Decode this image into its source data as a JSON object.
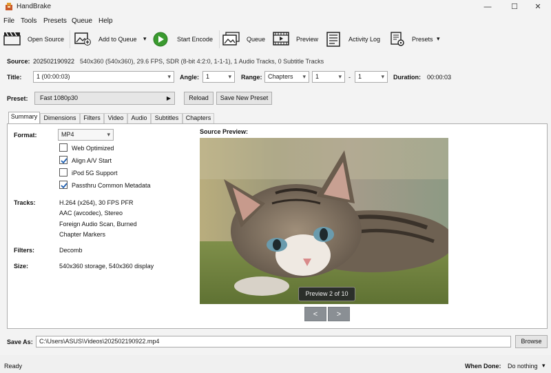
{
  "window": {
    "title": "HandBrake",
    "controls": [
      "—",
      "☐",
      "✕"
    ]
  },
  "menu": [
    "File",
    "Tools",
    "Presets",
    "Queue",
    "Help"
  ],
  "toolbar": {
    "open_source": "Open Source",
    "add_to_queue": "Add to Queue",
    "start_encode": "Start Encode",
    "queue": "Queue",
    "preview": "Preview",
    "activity_log": "Activity Log",
    "presets": "Presets"
  },
  "source": {
    "label": "Source:",
    "name": "202502190922",
    "info": "540x360 (540x360), 29.6 FPS, SDR (8-bit 4:2:0, 1-1-1), 1 Audio Tracks, 0 Subtitle Tracks"
  },
  "title_row": {
    "title_label": "Title:",
    "title_value": "1 (00:00:03)",
    "angle_label": "Angle:",
    "angle_value": "1",
    "range_label": "Range:",
    "range_type": "Chapters",
    "range_from": "1",
    "range_dash": "-",
    "range_to": "1",
    "duration_label": "Duration:",
    "duration_value": "00:00:03"
  },
  "preset": {
    "label": "Preset:",
    "value": "Fast 1080p30",
    "reload": "Reload",
    "save_new": "Save New Preset"
  },
  "tabs": [
    "Summary",
    "Dimensions",
    "Filters",
    "Video",
    "Audio",
    "Subtitles",
    "Chapters"
  ],
  "active_tab": "Summary",
  "summary": {
    "format_label": "Format:",
    "format_value": "MP4",
    "options": [
      {
        "label": "Web Optimized",
        "checked": false
      },
      {
        "label": "Align A/V Start",
        "checked": true
      },
      {
        "label": "iPod 5G Support",
        "checked": false
      },
      {
        "label": "Passthru Common Metadata",
        "checked": true
      }
    ],
    "tracks_label": "Tracks:",
    "tracks": [
      "H.264 (x264), 30 FPS PFR",
      "AAC (avcodec), Stereo",
      "Foreign Audio Scan, Burned",
      "Chapter Markers"
    ],
    "filters_label": "Filters:",
    "filters_value": "Decomb",
    "size_label": "Size:",
    "size_value": "540x360 storage, 540x360 display"
  },
  "preview": {
    "label": "Source Preview:",
    "badge": "Preview 2 of 10",
    "prev": "<",
    "next": ">"
  },
  "save_as": {
    "label": "Save As:",
    "path": "C:\\Users\\ASUS\\Videos\\202502190922.mp4",
    "browse": "Browse"
  },
  "status": {
    "text": "Ready",
    "when_done_label": "When Done:",
    "when_done_value": "Do nothing"
  },
  "colors": {
    "accent_green": "#3a9a2f",
    "check_blue": "#1f5fb0",
    "background": "#f3f3f3"
  }
}
